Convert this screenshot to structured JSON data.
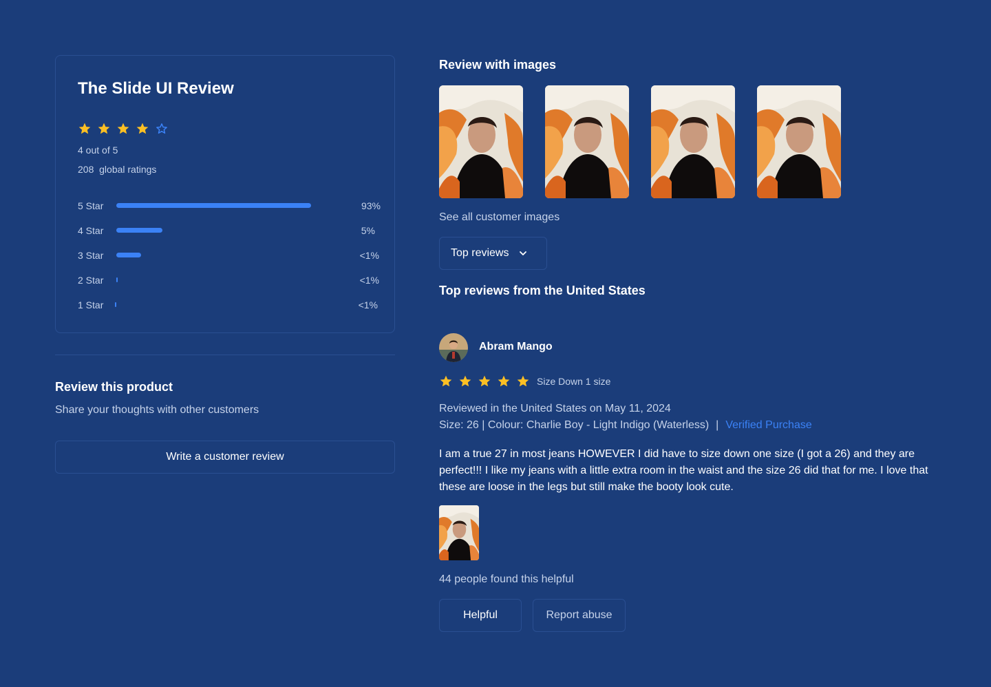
{
  "summary": {
    "title": "The Slide UI Review",
    "rating": 4,
    "max_rating": 5,
    "out_of_text": "4 out of 5",
    "global_ratings_text": "208  global ratings",
    "distribution": [
      {
        "label": "5 Star",
        "pct_text": "93%",
        "fill": 0.93
      },
      {
        "label": "4 Star",
        "pct_text": "5%",
        "fill": 0.22
      },
      {
        "label": "3 Star",
        "pct_text": "<1%",
        "fill": 0.12
      },
      {
        "label": "2 Star",
        "pct_text": "<1%",
        "fill": 0.006
      },
      {
        "label": "1 Star",
        "pct_text": "<1%",
        "fill": 0.006
      }
    ]
  },
  "review_product": {
    "title": "Review this product",
    "subtitle": "Share your thoughts with other customers",
    "write_button": "Write a customer review"
  },
  "images_section": {
    "title": "Review with images",
    "see_all": "See all customer images",
    "image_count": 4
  },
  "sort": {
    "selected": "Top reviews",
    "icon": "chevron-down-icon"
  },
  "top_reviews_title": "Top reviews from the United States",
  "review": {
    "name": "Abram Mango",
    "rating": 5,
    "size_note": "Size Down 1 size",
    "reviewed_in": "Reviewed in the United States on May 11, 2024",
    "size_colour": "Size: 26 | Colour: Charlie Boy - Light Indigo (Waterless)",
    "separator": "|",
    "verified": "Verified Purchase",
    "body": "I am a true 27 in most jeans HOWEVER I did have to size down one size (I got a 26) and they are perfect!!! I like my jeans with a little extra room in the waist and the size 26 did that for me. I love that these are loose in the legs but still make the booty look cute.",
    "helpful_count": "44 people found this helpful",
    "helpful_button": "Helpful",
    "report_button": "Report abuse"
  },
  "colors": {
    "background": "#1b3d7a",
    "star": "#fbbf24",
    "accent": "#3b82f6",
    "border": "#2a4f92"
  }
}
